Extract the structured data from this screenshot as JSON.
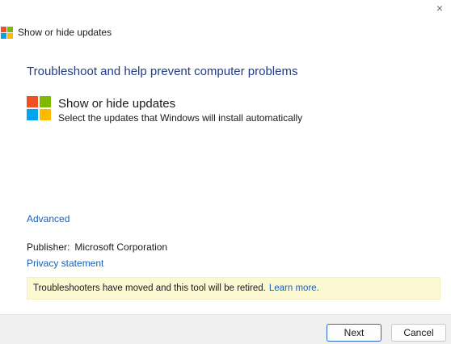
{
  "window": {
    "close_glyph": "×",
    "title": "Show or hide updates"
  },
  "colors": {
    "ms_red": "#f25022",
    "ms_green": "#7fba00",
    "ms_blue": "#00a4ef",
    "ms_yellow": "#ffb900",
    "heading": "#1f3c88",
    "link": "#1a5fb4",
    "banner_bg": "#fcf9d2"
  },
  "main": {
    "heading": "Troubleshoot and help prevent computer problems",
    "tool": {
      "icon": "windows-logo-icon",
      "title": "Show or hide updates",
      "description": "Select the updates that Windows will install automatically"
    },
    "advanced_link": "Advanced",
    "publisher_label": "Publisher:",
    "publisher_value": "Microsoft Corporation",
    "privacy_link": "Privacy statement",
    "banner": {
      "text": "Troubleshooters have moved and this tool will be retired.",
      "link": "Learn more."
    }
  },
  "footer": {
    "next_label": "Next",
    "cancel_label": "Cancel"
  }
}
